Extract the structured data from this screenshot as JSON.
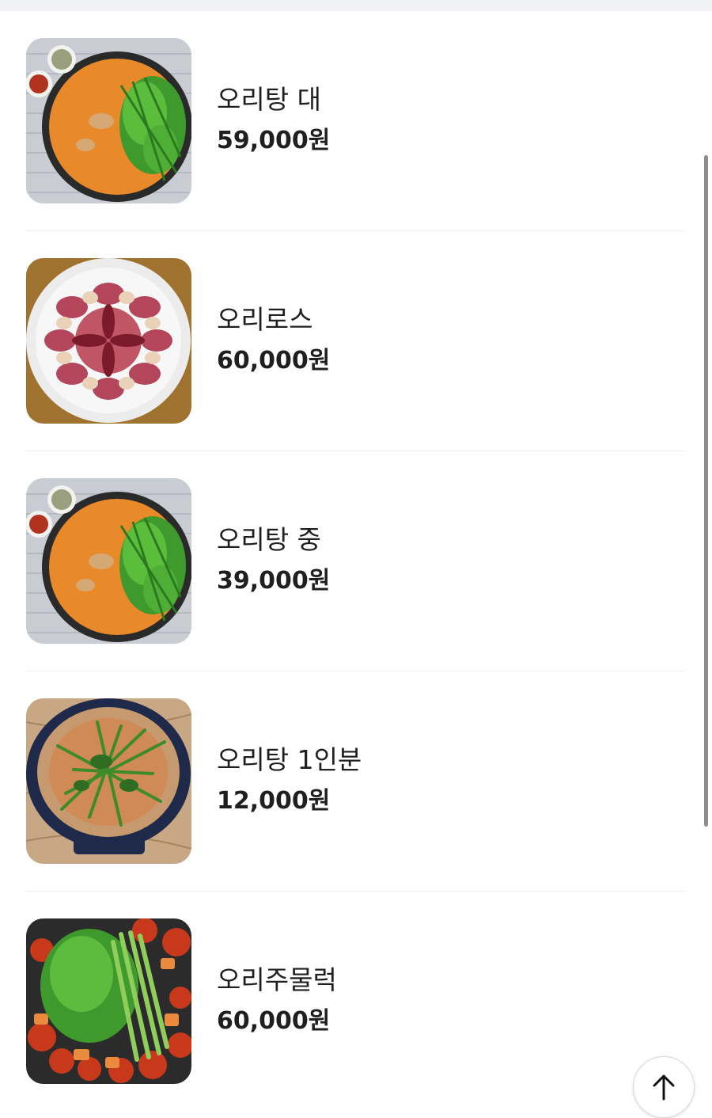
{
  "menu": {
    "items": [
      {
        "name": "오리탕 대",
        "price": "59,000원",
        "image": "duck-soup-large-photo"
      },
      {
        "name": "오리로스",
        "price": "60,000원",
        "image": "duck-roast-platter-photo"
      },
      {
        "name": "오리탕 중",
        "price": "39,000원",
        "image": "duck-soup-medium-photo"
      },
      {
        "name": "오리탕 1인분",
        "price": "12,000원",
        "image": "duck-soup-single-photo"
      },
      {
        "name": "오리주물럭",
        "price": "60,000원",
        "image": "spicy-duck-stirfry-photo"
      }
    ]
  },
  "scroll_top_button": {
    "icon": "arrow-up-icon"
  },
  "colors": {
    "text": "#1f1f1f",
    "divider": "#efefef",
    "top_strip": "#f1f2f6",
    "scrollbar": "#8e8e8e"
  }
}
